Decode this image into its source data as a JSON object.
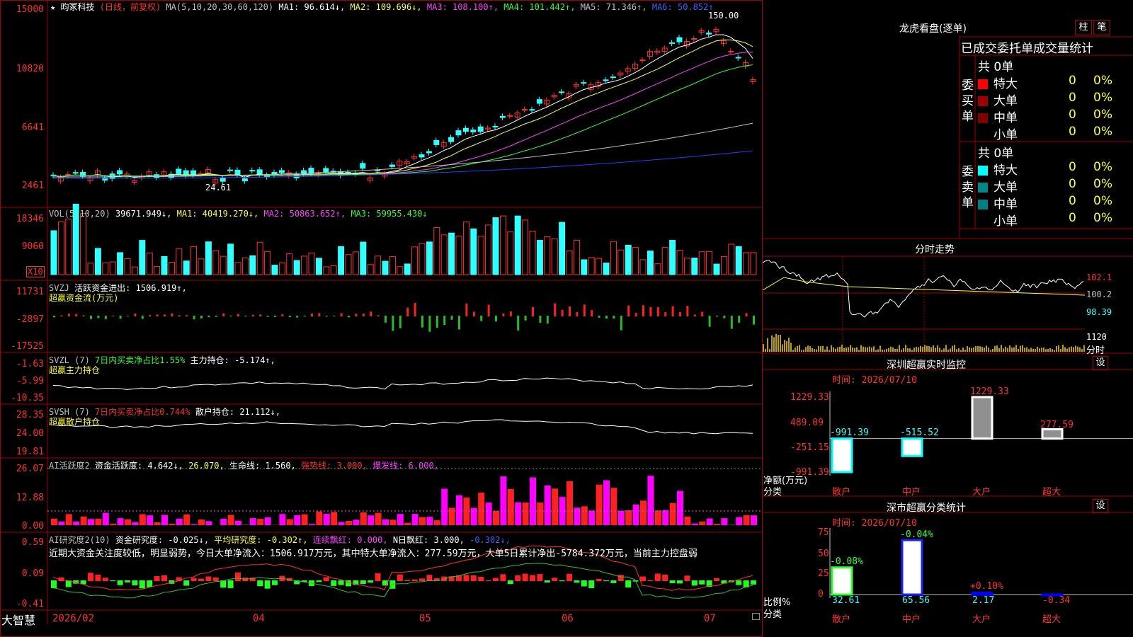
{
  "stock": {
    "star": "★",
    "name": "昀冢科技",
    "period": "(日线，前复权)"
  },
  "ma_line": {
    "label": "MA(5,10,20,30,60,120)",
    "ma1": "MA1: 96.614↓,",
    "ma2": "MA2: 109.696↓,",
    "ma3": "MA3: 108.100↑,",
    "ma4": "MA4: 101.442↑,",
    "ma5": "MA5: 71.346↑,",
    "ma6": "MA6: 50.852↑"
  },
  "price_axis": [
    "15000",
    "10820",
    "6641",
    "2461"
  ],
  "price_marks": {
    "high": "150.00",
    "low": "24.61"
  },
  "vol": {
    "label": "VOL(5,10,20)",
    "value": "39671.949↓,",
    "ma1": "MA1: 40419.270↓,",
    "ma2": "MA2: 50863.652↑,",
    "ma3": "MA3: 59955.430↓"
  },
  "vol_axis": [
    "18346",
    "9060",
    "X10"
  ],
  "svzj": {
    "label": "SVZJ",
    "title": "活跃资金进出: 1506.919↑,",
    "sub": "超赢资金流(万元)"
  },
  "svzj_axis": [
    "11731",
    "-2897",
    "-17525"
  ],
  "svzl": {
    "label": "SVZL (7)",
    "t1": "7日内买卖净占比1.55%",
    "t2": "主力持仓: -5.174↑,",
    "sub": "超赢主力持仓"
  },
  "svzl_axis": [
    "-1.63",
    "-5.99",
    "-10.35"
  ],
  "svsh": {
    "label": "SVSH (7)",
    "t1": "7日内买卖净占比0.744%",
    "t2": "散户持仓: 21.112↓,",
    "sub": "超赢散户持仓"
  },
  "svsh_axis": [
    "28.35",
    "24.00",
    "19.81"
  ],
  "ai1": {
    "label": "AI活跃度2",
    "t1": "资金活跃度: 4.642↓,",
    "t2": "26.070,",
    "t3": "生命线: 1.560,",
    "t4": "强势线: 3.000,",
    "t5": "爆发线: 6.000,"
  },
  "ai1_axis": [
    "26.07",
    "12.88",
    "0.00"
  ],
  "ai2": {
    "label": "AI研究度2(10)",
    "t1": "资金研究度: -0.025↓,",
    "t2": "平均研究度: -0.302↑,",
    "t3": "连续飘红: 0.000,",
    "t4": "N日飘红: 3.000,",
    "t5": "-0.302↓,"
  },
  "ai2_note": "近期大资金关注度较低，明显弱势，今日大单净流入：1506.917万元，其中特大单净流入：277.59万元，大单5日累计净出-5784.372万元，当前主力控盘弱",
  "ai2_axis": [
    "0.59",
    "0.09",
    "-0.41"
  ],
  "brand": "大智慧",
  "dates": [
    "2026/02",
    "04",
    "05",
    "06",
    "07"
  ],
  "right": {
    "lhb_title": "龙虎看盘(逐单)",
    "btn_zhu": "柱",
    "btn_bi": "笔",
    "header": "已成交委托单成交量统计",
    "buy_label": "委买单",
    "sell_label": "委卖单",
    "buy_total": "共 0单",
    "sell_total": "共 0单",
    "rows": [
      "特大",
      "大单",
      "中单",
      "小单"
    ],
    "zero": "0",
    "pct": "0%",
    "colors_buy": [
      "#ff0000",
      "#a00000",
      "#800000"
    ],
    "colors_sell": [
      "#00ffff",
      "#008888",
      "#008080"
    ],
    "fs_title": "分时走势",
    "fs_axis": [
      "102.1",
      "100.2",
      "98.39",
      "1120",
      "分时"
    ],
    "sz_title": "深圳超赢实时监控",
    "time_label": "时间: 2026/07/10",
    "she": "设",
    "bar_axis": [
      "1229.33",
      "489.09",
      "-251.15",
      "-991.39"
    ],
    "bar_vals": [
      "-991.39",
      "-515.52",
      "1229.33",
      "277.59"
    ],
    "bar_cats": [
      "散户",
      "中户",
      "大户",
      "超大"
    ],
    "net_label": "净额(万元)",
    "cls_label": "分类",
    "fl_title": "深市超赢分类统计",
    "pct_axis": [
      "75",
      "50",
      "25",
      "0"
    ],
    "pct_top": [
      "-0.08%",
      "-0.04%",
      "+0.10%",
      ""
    ],
    "pct_vals": [
      "32.61",
      "65.56",
      "2.17",
      "-0.34"
    ],
    "ratio_label": "比例%"
  },
  "chart_data": {
    "type": "bar",
    "title": "深圳超赢实时监控",
    "categories": [
      "散户",
      "中户",
      "大户",
      "超大"
    ],
    "values": [
      -991.39,
      -515.52,
      1229.33,
      277.59
    ],
    "ylim": [
      -991.39,
      1229.33
    ]
  }
}
